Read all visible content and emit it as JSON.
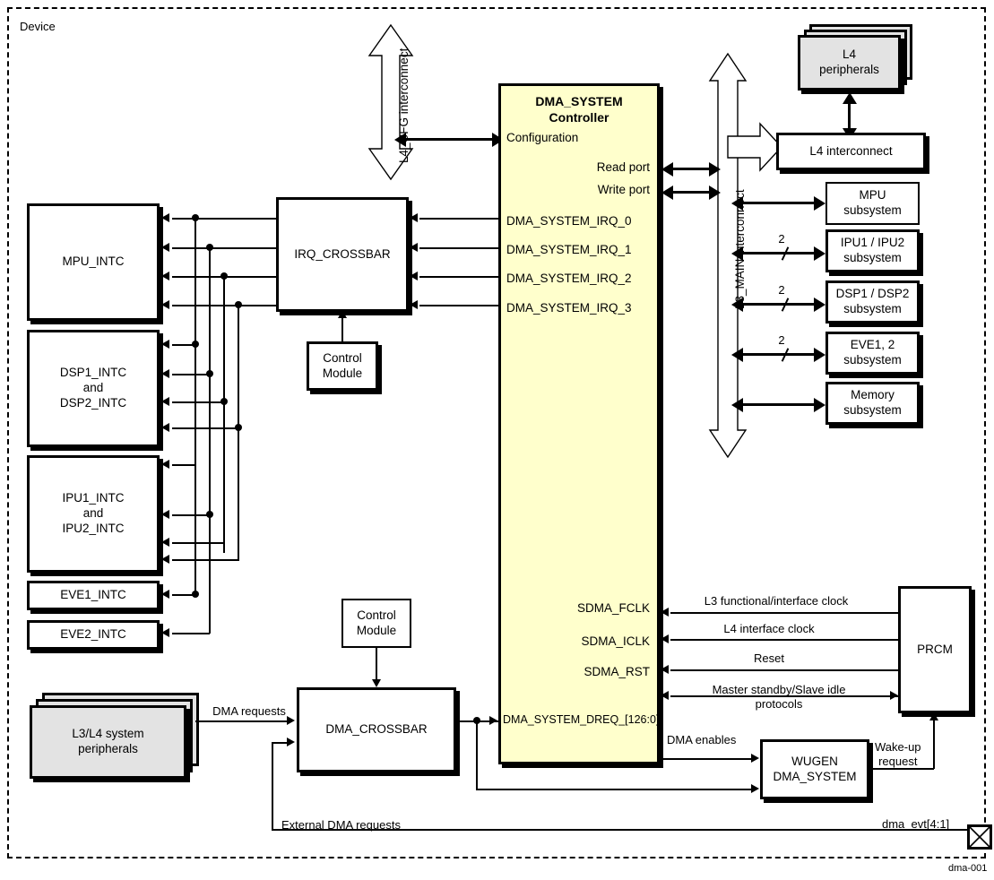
{
  "figure": {
    "device_label": "Device",
    "figure_id": "dma-001"
  },
  "interconnects": {
    "l4_cfg": "L4_CFG interconnect",
    "l3_main": "L3_MAIN interconnect",
    "l4": "L4 interconnect"
  },
  "controller": {
    "title_line1": "DMA_SYSTEM",
    "title_line2": "Controller",
    "fill_color": "#ffffcc",
    "ports": {
      "configuration": "Configuration",
      "read_port": "Read port",
      "write_port": "Write port",
      "irq0": "DMA_SYSTEM_IRQ_0",
      "irq1": "DMA_SYSTEM_IRQ_1",
      "irq2": "DMA_SYSTEM_IRQ_2",
      "irq3": "DMA_SYSTEM_IRQ_3",
      "fclk": "SDMA_FCLK",
      "iclk": "SDMA_ICLK",
      "rst": "SDMA_RST",
      "dreq": "DMA_SYSTEM_DREQ_[126:0]"
    }
  },
  "left_blocks": {
    "mpu_intc": "MPU_INTC",
    "dsp_intc": "DSP1_INTC\nand\nDSP2_INTC",
    "dsp_intc_l1": "DSP1_INTC",
    "dsp_intc_l2": "and",
    "dsp_intc_l3": "DSP2_INTC",
    "ipu_intc_l1": "IPU1_INTC",
    "ipu_intc_l2": "and",
    "ipu_intc_l3": "IPU2_INTC",
    "eve1_intc": "EVE1_INTC",
    "eve2_intc": "EVE2_INTC",
    "irq_crossbar": "IRQ_CROSSBAR",
    "control_module_l1": "Control",
    "control_module_l2": "Module",
    "dma_crossbar": "DMA_CROSSBAR",
    "l3l4_periph_l1": "L3/L4 system",
    "l3l4_periph_l2": "peripherals"
  },
  "right_blocks": {
    "l4_peripherals_l1": "L4",
    "l4_peripherals_l2": "peripherals",
    "l4_interconnect": "L4 interconnect",
    "mpu_sub_l1": "MPU",
    "mpu_sub_l2": "subsystem",
    "ipu_sub_l1": "IPU1 / IPU2",
    "ipu_sub_l2": "subsystem",
    "dsp_sub_l1": "DSP1 / DSP2",
    "dsp_sub_l2": "subsystem",
    "eve_sub_l1": "EVE1, 2",
    "eve_sub_l2": "subsystem",
    "mem_sub_l1": "Memory",
    "mem_sub_l2": "subsystem",
    "prcm": "PRCM",
    "wugen_l1": "WUGEN",
    "wugen_l2": "DMA_SYSTEM"
  },
  "bus_widths": {
    "ipu": "2",
    "dsp": "2",
    "eve": "2"
  },
  "signals": {
    "dma_requests": "DMA requests",
    "external_dma_requests": "External DMA requests",
    "l3_clock": "L3 functional/interface clock",
    "l4_clock": "L4 interface clock",
    "reset": "Reset",
    "standby_l1": "Master standby/Slave idle",
    "standby_l2": "protocols",
    "dma_enables": "DMA enables",
    "wakeup_l1": "Wake-up",
    "wakeup_l2": "request",
    "dma_evt": "dma_evt[4:1]"
  }
}
